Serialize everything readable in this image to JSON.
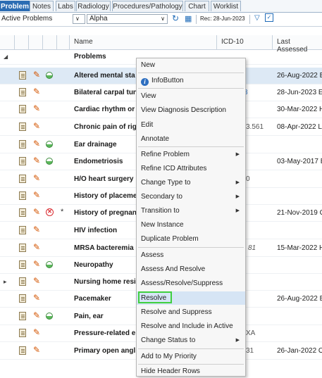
{
  "tabs": [
    "Problem",
    "Notes",
    "Labs",
    "Radiology",
    "Procedures/Pathology",
    "Chart",
    "Worklist"
  ],
  "toolbar": {
    "filter_value": "Active Problems",
    "sort_value": "Alpha",
    "rec_label": "Rec: 28-Jun-2023"
  },
  "grid": {
    "columns": [
      "Name",
      "ICD-10",
      "Last Assessed"
    ],
    "group_label": "Problems",
    "rows": [
      {
        "name": "Altered mental sta",
        "icd": "",
        "date": "26-Aug-2022 B"
      },
      {
        "name": "Bilateral carpal tun",
        "icd": "3",
        "date": "28-Jun-2023 Et"
      },
      {
        "name": "Cardiac rhythm or",
        "icd": "",
        "date": "30-Mar-2022 H"
      },
      {
        "name": "Chronic pain of rig",
        "icd": "3.561",
        "date": "08-Apr-2022 Li"
      },
      {
        "name": "Ear drainage",
        "icd": "",
        "date": ""
      },
      {
        "name": "Endometriosis",
        "icd": "",
        "date": "03-May-2017 E"
      },
      {
        "name": "H/O heart surgery",
        "icd": "0",
        "date": ""
      },
      {
        "name": "History of placeme",
        "icd": "",
        "date": ""
      },
      {
        "name": "History of pregnan",
        "icd": "",
        "date": "21-Nov-2019 C"
      },
      {
        "name": "HIV infection",
        "icd": "",
        "date": ""
      },
      {
        "name": "MRSA bacteremia",
        "icd": "81",
        "date": "15-Mar-2022 H"
      },
      {
        "name": "Neuropathy",
        "icd": "",
        "date": ""
      },
      {
        "name": "Nursing home resi",
        "icd": "",
        "date": ""
      },
      {
        "name": "Pacemaker",
        "icd": "",
        "date": "26-Aug-2022 B"
      },
      {
        "name": "Pain, ear",
        "icd": "",
        "date": ""
      },
      {
        "name": "Pressure-related e",
        "icd": "XA",
        "date": ""
      },
      {
        "name": "Primary open angl",
        "icd": "31",
        "date": "26-Jan-2022 O"
      }
    ]
  },
  "context_menu": {
    "items": [
      "New",
      "InfoButton",
      "View",
      "View Diagnosis Description",
      "Edit",
      "Annotate",
      "Refine Problem",
      "Refine ICD Attributes",
      "Change Type to",
      "Secondary to",
      "Transition to",
      "New Instance",
      "Duplicate Problem",
      "Assess",
      "Assess And Resolve",
      "Assess/Resolve/Suppress",
      "Resolve",
      "Resolve and Suppress",
      "Resolve and Include in Active",
      "Change Status to",
      "Add to My Priority",
      "Hide Header Rows"
    ],
    "highlighted": "Resolve"
  }
}
